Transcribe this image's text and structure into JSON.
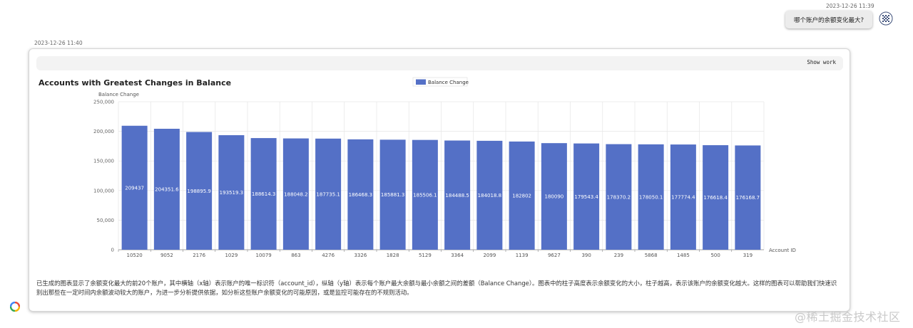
{
  "user_message": {
    "timestamp": "2023-12-26 11:39",
    "text": "哪个账户的余额变化最大?",
    "avatar_icon": "user-avatar-icon"
  },
  "bot_message": {
    "timestamp": "2023-12-26 11:40",
    "show_work_label": "Show work",
    "description": "已生成的图表显示了余额变化最大的前20个账户，其中横轴（x轴）表示账户的唯一标识符（account_id），纵轴（y轴）表示每个账户最大余额与最小余额之间的差额（Balance Change）。图表中的柱子高度表示余额变化的大小，柱子越高，表示该账户的余额变化越大。这样的图表可以帮助我们快速识别出那些在一定时间内余额波动较大的账户，为进一步分析提供依据，如分析这些账户余额变化的可能原因，或是监控可能存在的不规则活动。"
  },
  "watermark": "@稀土掘金技术社区",
  "colors": {
    "bar": "#5470c6",
    "bar_label": "#ffffff",
    "grid": "#e6e6e6"
  },
  "chart_data": {
    "type": "bar",
    "title": "Accounts with Greatest Changes in Balance",
    "xlabel": "Account ID",
    "ylabel": "Balance Change",
    "legend": [
      "Balance Change"
    ],
    "legend_position": "top-center",
    "grid": true,
    "ylim": [
      0,
      250000
    ],
    "yticks": [
      "0",
      "50,000",
      "100,000",
      "150,000",
      "200,000",
      "250,000"
    ],
    "categories": [
      "10520",
      "9052",
      "2176",
      "1029",
      "10079",
      "863",
      "4276",
      "3326",
      "1828",
      "5129",
      "3364",
      "2099",
      "1139",
      "9627",
      "390",
      "239",
      "5868",
      "1485",
      "500",
      "319"
    ],
    "series": [
      {
        "name": "Balance Change",
        "values": [
          209437,
          204351.6,
          198895.9,
          193519.3,
          188614.3,
          188048.2,
          187735.1,
          186468.3,
          185881.3,
          185506.1,
          184488.5,
          184018.8,
          182802,
          180090,
          179543.4,
          178370.2,
          178050.1,
          177774.4,
          176618.4,
          176168.7
        ],
        "labels": [
          "209437",
          "204351.6",
          "198895.9",
          "193519.3",
          "188614.3",
          "188048.2",
          "187735.1",
          "186468.3",
          "185881.3",
          "185506.1",
          "184488.5",
          "184018.8",
          "182802",
          "180090",
          "179543.4",
          "178370.2",
          "178050.1",
          "177774.4",
          "176618.4",
          "176168.7"
        ]
      }
    ]
  }
}
